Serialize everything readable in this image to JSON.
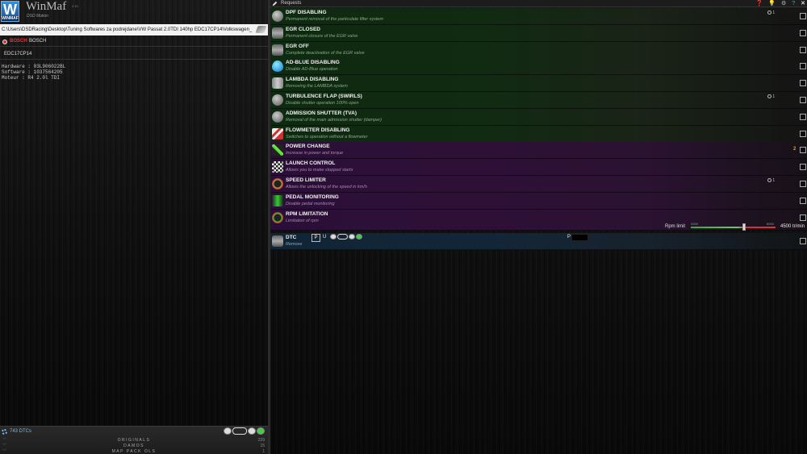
{
  "app": {
    "logo_letter": "W",
    "logo_sub": "WINMAF",
    "title": "WinMaf",
    "version": "2.10",
    "subtitle": "DSD Motion"
  },
  "file_path": "C:\\Users\\DSDRacing\\Desktop\\Tuning Softwares za podrejdane\\VW Passat 2.0TDI 140hp EDC17CP14\\Volkswagen_",
  "manufacturer": {
    "logo": "BOSCH",
    "name": "BOSCH"
  },
  "ecu": "EDC17CP14",
  "info_lines": [
    "Hardware : 03L906022BL",
    "Software : 1037564205",
    "Moteur : R4 2.0l TDI"
  ],
  "footer": {
    "dtc_count": "743 DTCs",
    "rows": [
      {
        "label": "ORIGINALS",
        "count": "239"
      },
      {
        "label": "DAMOS",
        "count": "15"
      },
      {
        "label": "MAP PACK OLS",
        "count": "1"
      }
    ]
  },
  "requests": {
    "title": "Requests",
    "top_icons": [
      "help-icon",
      "lightbulb-icon",
      "settings-icon",
      "info-icon",
      "close-icon"
    ],
    "items": [
      {
        "title": "DPF DISABLING",
        "desc": "Permanent removal of the particulate filter system",
        "theme": "green",
        "icon": "dpf-icon",
        "opt": "1"
      },
      {
        "title": "EGR CLOSED",
        "desc": "Permanent closure of the EGR valve",
        "theme": "green",
        "icon": "egr-closed-icon"
      },
      {
        "title": "EGR OFF",
        "desc": "Complete deactivation of the EGR valve",
        "theme": "green",
        "icon": "egr-off-icon"
      },
      {
        "title": "AD-BLUE DISABLING",
        "desc": "Disable AD-Blue operation",
        "theme": "green",
        "icon": "adblue-drop-icon"
      },
      {
        "title": "LAMBDA DISABLING",
        "desc": "Removing the LAMBDA system",
        "theme": "green",
        "icon": "lambda-sensor-icon"
      },
      {
        "title": "TURBULENCE FLAP (SWIRLS)",
        "desc": "Disable shutter operation 100% open",
        "theme": "green",
        "icon": "swirl-flap-icon",
        "opt": "1"
      },
      {
        "title": "ADMISSION SHUTTER (TVA)",
        "desc": "Removal of the main admission shutter (damper)",
        "theme": "green",
        "icon": "throttle-icon"
      },
      {
        "title": "FLOWMETER DISABLING",
        "desc": "Switches to operation without a flowmeter",
        "theme": "green",
        "icon": "flowmeter-icon"
      },
      {
        "title": "POWER CHANGE",
        "desc": "Increase in power and torque",
        "theme": "purple",
        "icon": "power-chart-icon",
        "num": "2"
      },
      {
        "title": "LAUNCH CONTROL",
        "desc": "Allows you to make stopped starts",
        "theme": "purple",
        "icon": "checkered-flag-icon"
      },
      {
        "title": "SPEED LIMITER",
        "desc": "Allows the unlocking of the speed in km/h",
        "theme": "purple",
        "icon": "speedometer-icon",
        "opt": "1"
      },
      {
        "title": "PEDAL MONITORING",
        "desc": "Disable pedal monitoring",
        "theme": "purple",
        "icon": "pedal-wave-icon"
      },
      {
        "title": "RPM LIMITATION",
        "desc": "Limitation of rpm",
        "theme": "purple",
        "icon": "rpm-gauge-icon"
      }
    ],
    "rpm_slider": {
      "label": "Rpm limit",
      "min": "2000",
      "max": "6000",
      "value": 4500,
      "value_text": "4500 tr/min"
    },
    "dtc": {
      "title": "DTC",
      "desc": "Remove",
      "p_label": "P",
      "u_label": "U",
      "code_prefix": "P"
    }
  }
}
